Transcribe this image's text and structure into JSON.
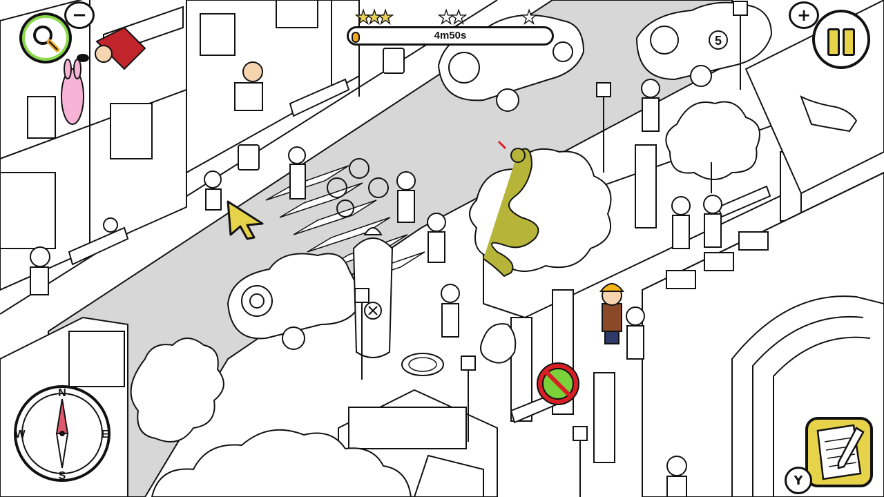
{
  "hud": {
    "zoom_out_label": "−",
    "zoom_in_label": "+",
    "timer_text": "4m50s",
    "timer_progress": 0.02,
    "stars": [
      {
        "filled": true
      },
      {
        "filled": true
      },
      {
        "filled": true
      },
      {
        "filled": false
      },
      {
        "filled": false
      },
      {
        "filled": false
      }
    ],
    "notes_badge": "Y"
  },
  "compass": {
    "north": "N",
    "south": "S",
    "east": "E",
    "west": "W"
  },
  "scene": {
    "race_car_number": "5",
    "icons": {
      "magnifier": "magnifier-icon",
      "pause": "pause-icon",
      "notebook": "notebook-pencil-icon",
      "cursor": "pointer-arrow-icon"
    },
    "colors": {
      "star_gold": "#e6cf57",
      "timer_fill": "#f4a81d",
      "magnifier_ring": "#8ad94a",
      "snake": "#b7b43a",
      "no_entry_red": "#d81f26",
      "no_entry_green": "#7bd13a",
      "pink_bunny": "#f6b3d6",
      "road": "#d7d7d7"
    }
  }
}
